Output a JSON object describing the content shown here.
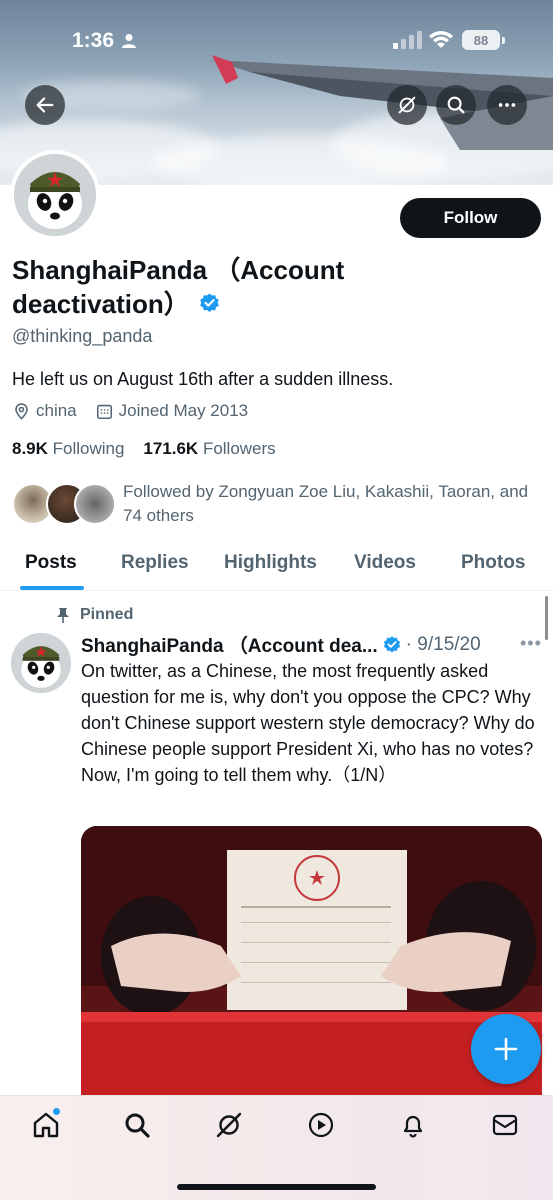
{
  "status_bar": {
    "time": "1:36",
    "battery": "88"
  },
  "profile": {
    "follow_label": "Follow",
    "display_name": "ShanghaiPanda （Account deactivation）",
    "handle": "@thinking_panda",
    "bio": "He left us on August 16th after a sudden illness.",
    "location": "china",
    "joined": "Joined May 2013",
    "following_count": "8.9K",
    "following_label": "Following",
    "followers_count": "171.6K",
    "followers_label": "Followers",
    "followed_by": "Followed by Zongyuan Zoe Liu, Kakashii, Taoran, and 74 others"
  },
  "tabs": [
    {
      "label": "Posts",
      "active": true
    },
    {
      "label": "Replies"
    },
    {
      "label": "Highlights"
    },
    {
      "label": "Videos"
    },
    {
      "label": "Photos"
    }
  ],
  "tweet": {
    "pinned_label": "Pinned",
    "author": "ShanghaiPanda （Account dea...",
    "date": "· 9/15/20",
    "text": "On twitter, as a Chinese, the most frequently asked question for me is, why don't you oppose the CPC? Why don't Chinese support western style democracy? Why do Chinese people support President Xi, who has no votes? Now, I'm going to tell them why.（1/N）"
  },
  "colors": {
    "accent": "#1d9bf0",
    "text": "#0f1419",
    "muted": "#536471"
  },
  "icons": [
    "back-arrow-icon",
    "grok-icon",
    "search-icon",
    "more-icon",
    "verified-badge-icon",
    "location-icon",
    "calendar-icon",
    "pin-icon",
    "plus-icon",
    "home-icon",
    "explore-icon",
    "video-icon",
    "notifications-icon",
    "messages-icon"
  ]
}
